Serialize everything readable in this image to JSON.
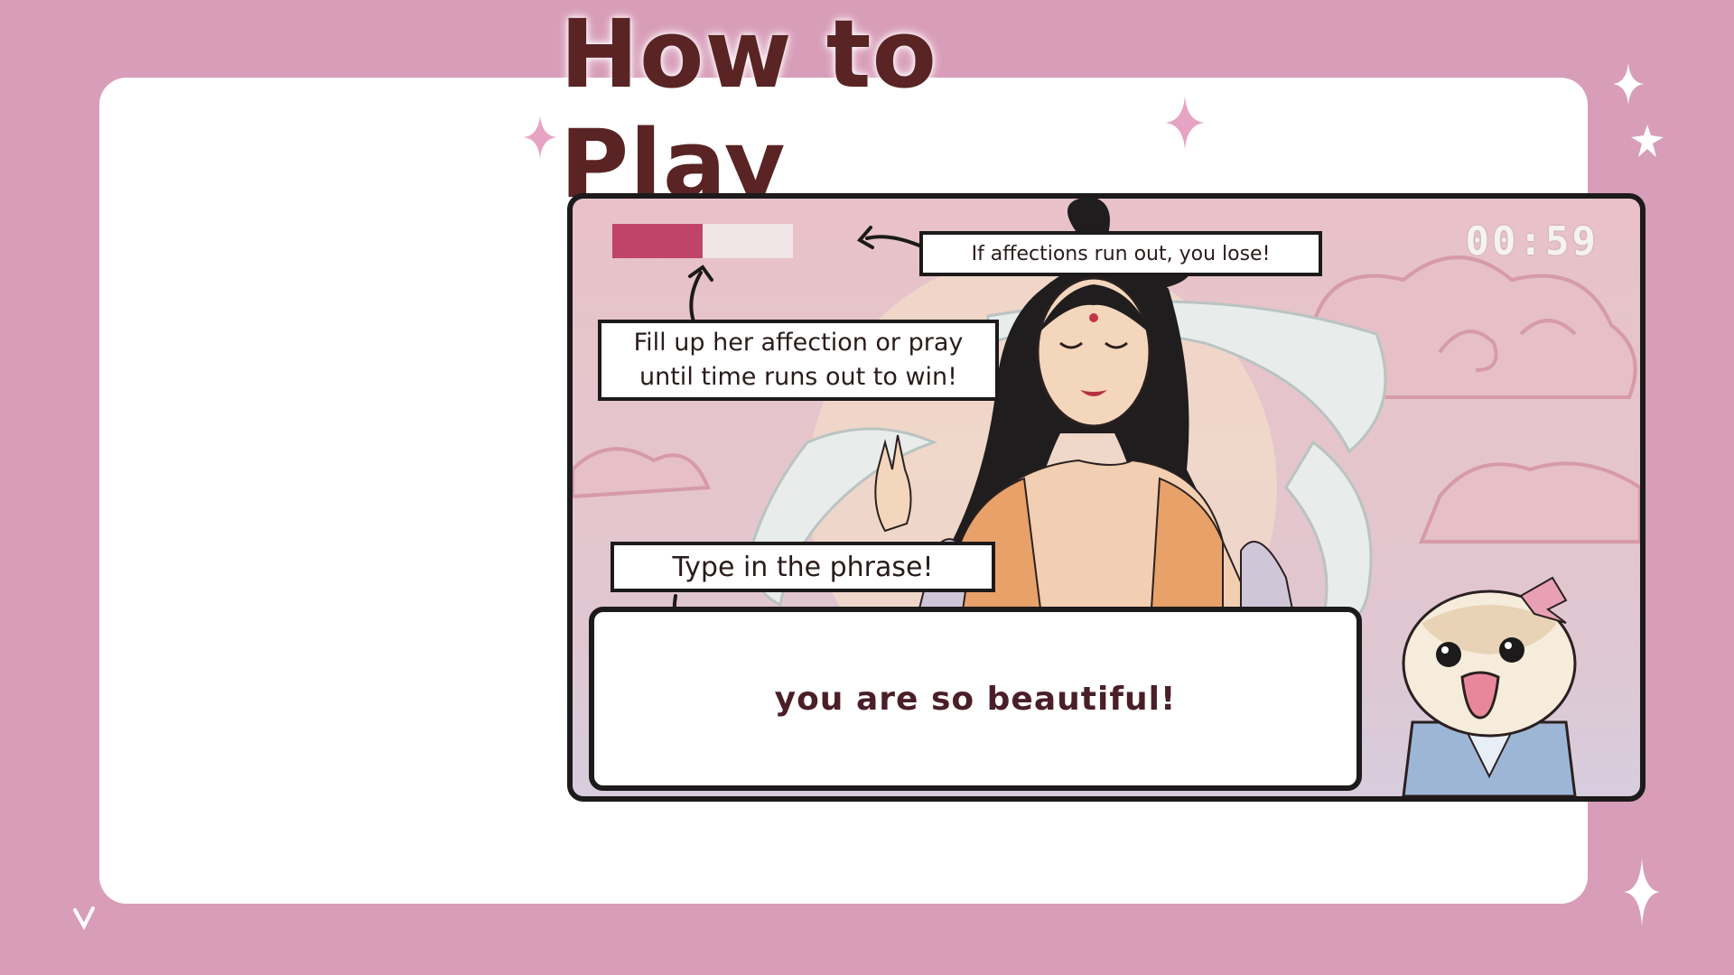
{
  "page": {
    "title": "How to Play"
  },
  "game": {
    "timer": "00:59",
    "affection": {
      "level": 0.5
    },
    "callouts": {
      "lose": "If  affections run out, you lose!",
      "fill_line1": "Fill up her affection or pray",
      "fill_line2": "until time runs out to win!",
      "type": "Type in the phrase!"
    },
    "phrase": "you are so beautiful!"
  },
  "colors": {
    "background": "#d89db8",
    "title": "#5a2424",
    "affection_fill": "#c0446a",
    "affection_empty": "#f0e6e8"
  },
  "icons": [
    "sparkle-icon",
    "arrow-icon",
    "goddess-character",
    "hamster-mascot"
  ]
}
